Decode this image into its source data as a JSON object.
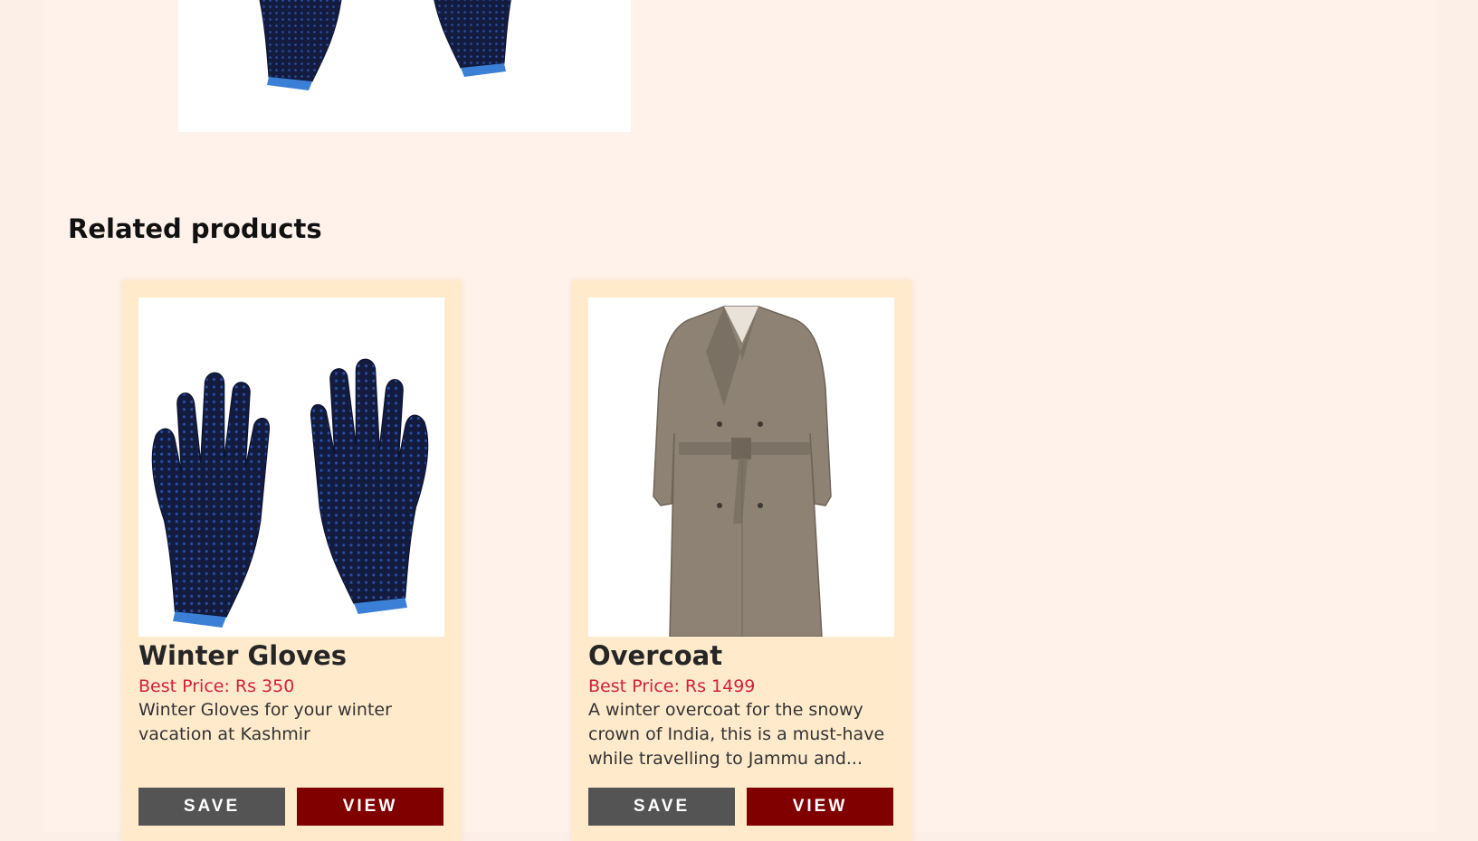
{
  "related": {
    "title": "Related products",
    "products": [
      {
        "name": "Winter Gloves",
        "price": "Best Price: Rs 350",
        "description": "Winter Gloves for your winter vacation at Kashmir",
        "save_label": "SAVE",
        "view_label": "VIEW",
        "image": "winter-gloves-image"
      },
      {
        "name": "Overcoat",
        "price": "Best Price: Rs 1499",
        "description": "A winter overcoat for the snowy crown of India, this is a must-have while travelling to Jammu and...",
        "save_label": "SAVE",
        "view_label": "VIEW",
        "image": "overcoat-image"
      }
    ]
  },
  "colors": {
    "page_bg": "#fff2ea",
    "card_bg": "#ffebcc",
    "price": "#d0223a",
    "save_button": "#545454",
    "view_button": "#800000"
  }
}
